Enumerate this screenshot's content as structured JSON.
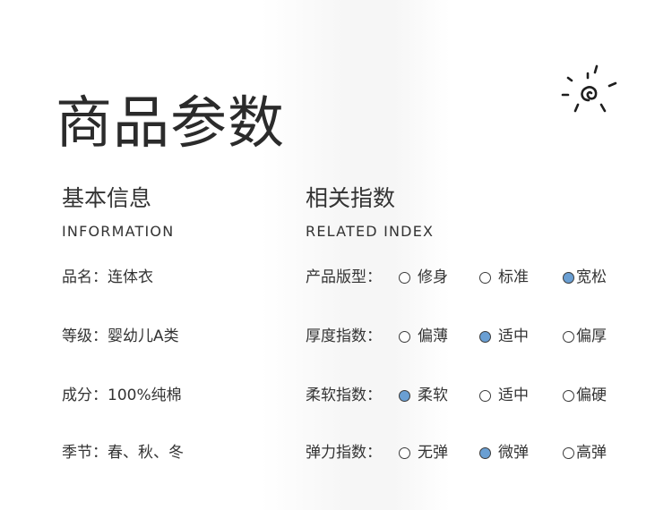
{
  "title": "商品参数",
  "basic": {
    "title": "基本信息",
    "subtitle": "INFORMATION",
    "rows": [
      "品名：连体衣",
      "等级：婴幼儿A类",
      "成分：100%纯棉",
      "季节：春、秋、冬"
    ]
  },
  "related": {
    "title": "相关指数",
    "subtitle": "RELATED INDEX",
    "rows": [
      {
        "label": "产品版型：",
        "options": [
          {
            "text": "修身",
            "selected": false
          },
          {
            "text": "标准",
            "selected": false
          },
          {
            "text": "宽松",
            "selected": true
          }
        ]
      },
      {
        "label": "厚度指数：",
        "options": [
          {
            "text": "偏薄",
            "selected": false
          },
          {
            "text": "适中",
            "selected": true
          },
          {
            "text": "偏厚",
            "selected": false
          }
        ]
      },
      {
        "label": "柔软指数：",
        "options": [
          {
            "text": "柔软",
            "selected": true
          },
          {
            "text": "适中",
            "selected": false
          },
          {
            "text": "偏硬",
            "selected": false
          }
        ]
      },
      {
        "label": "弹力指数：",
        "options": [
          {
            "text": "无弹",
            "selected": false
          },
          {
            "text": "微弹",
            "selected": true
          },
          {
            "text": "高弹",
            "selected": false
          }
        ]
      }
    ]
  },
  "colors": {
    "selected": "#6a9fd3",
    "text": "#333333"
  },
  "icons": {
    "decoration": "sun-swirl-icon"
  }
}
